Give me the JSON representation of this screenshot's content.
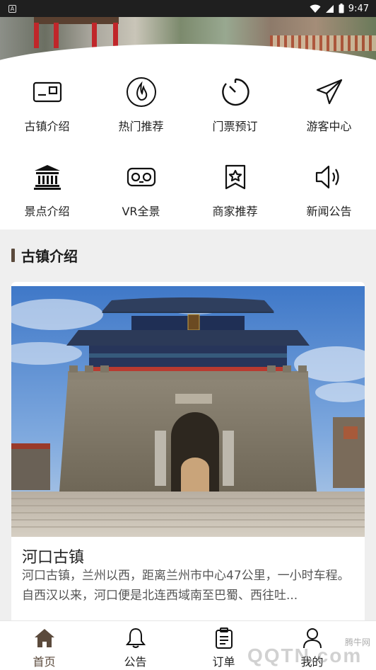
{
  "status_bar": {
    "time": "9:47",
    "notification_icon": "app-notification-icon",
    "wifi_icon": "wifi-icon",
    "battery_icon": "battery-icon"
  },
  "banner": {
    "slide_count": 7,
    "active_slide": 1
  },
  "menu": {
    "items": [
      {
        "label": "古镇介绍",
        "icon": "id-card-icon"
      },
      {
        "label": "热门推荐",
        "icon": "flame-icon"
      },
      {
        "label": "门票预订",
        "icon": "timer-icon"
      },
      {
        "label": "游客中心",
        "icon": "paper-plane-icon"
      },
      {
        "label": "景点介绍",
        "icon": "temple-icon"
      },
      {
        "label": "VR全景",
        "icon": "vr-goggles-icon"
      },
      {
        "label": "商家推荐",
        "icon": "star-badge-icon"
      },
      {
        "label": "新闻公告",
        "icon": "speaker-icon"
      }
    ]
  },
  "section": {
    "title": "古镇介绍"
  },
  "card": {
    "name": "河口古镇",
    "description": "河口古镇，兰州以西，距离兰州市中心47公里，一小时车程。自西汉以来，河口便是北连西域南至巴蜀、西往吐..."
  },
  "bottom_nav": {
    "items": [
      {
        "label": "首页",
        "icon": "home-icon",
        "active": true
      },
      {
        "label": "公告",
        "icon": "bell-icon",
        "active": false
      },
      {
        "label": "订单",
        "icon": "clipboard-icon",
        "active": false
      },
      {
        "label": "我的",
        "icon": "user-icon",
        "active": false
      }
    ]
  },
  "watermark": {
    "top": "腾牛网",
    "main": "QQTN.com"
  },
  "colors": {
    "accent": "#5b4a3c",
    "background": "#efefef",
    "card": "#ffffff"
  }
}
